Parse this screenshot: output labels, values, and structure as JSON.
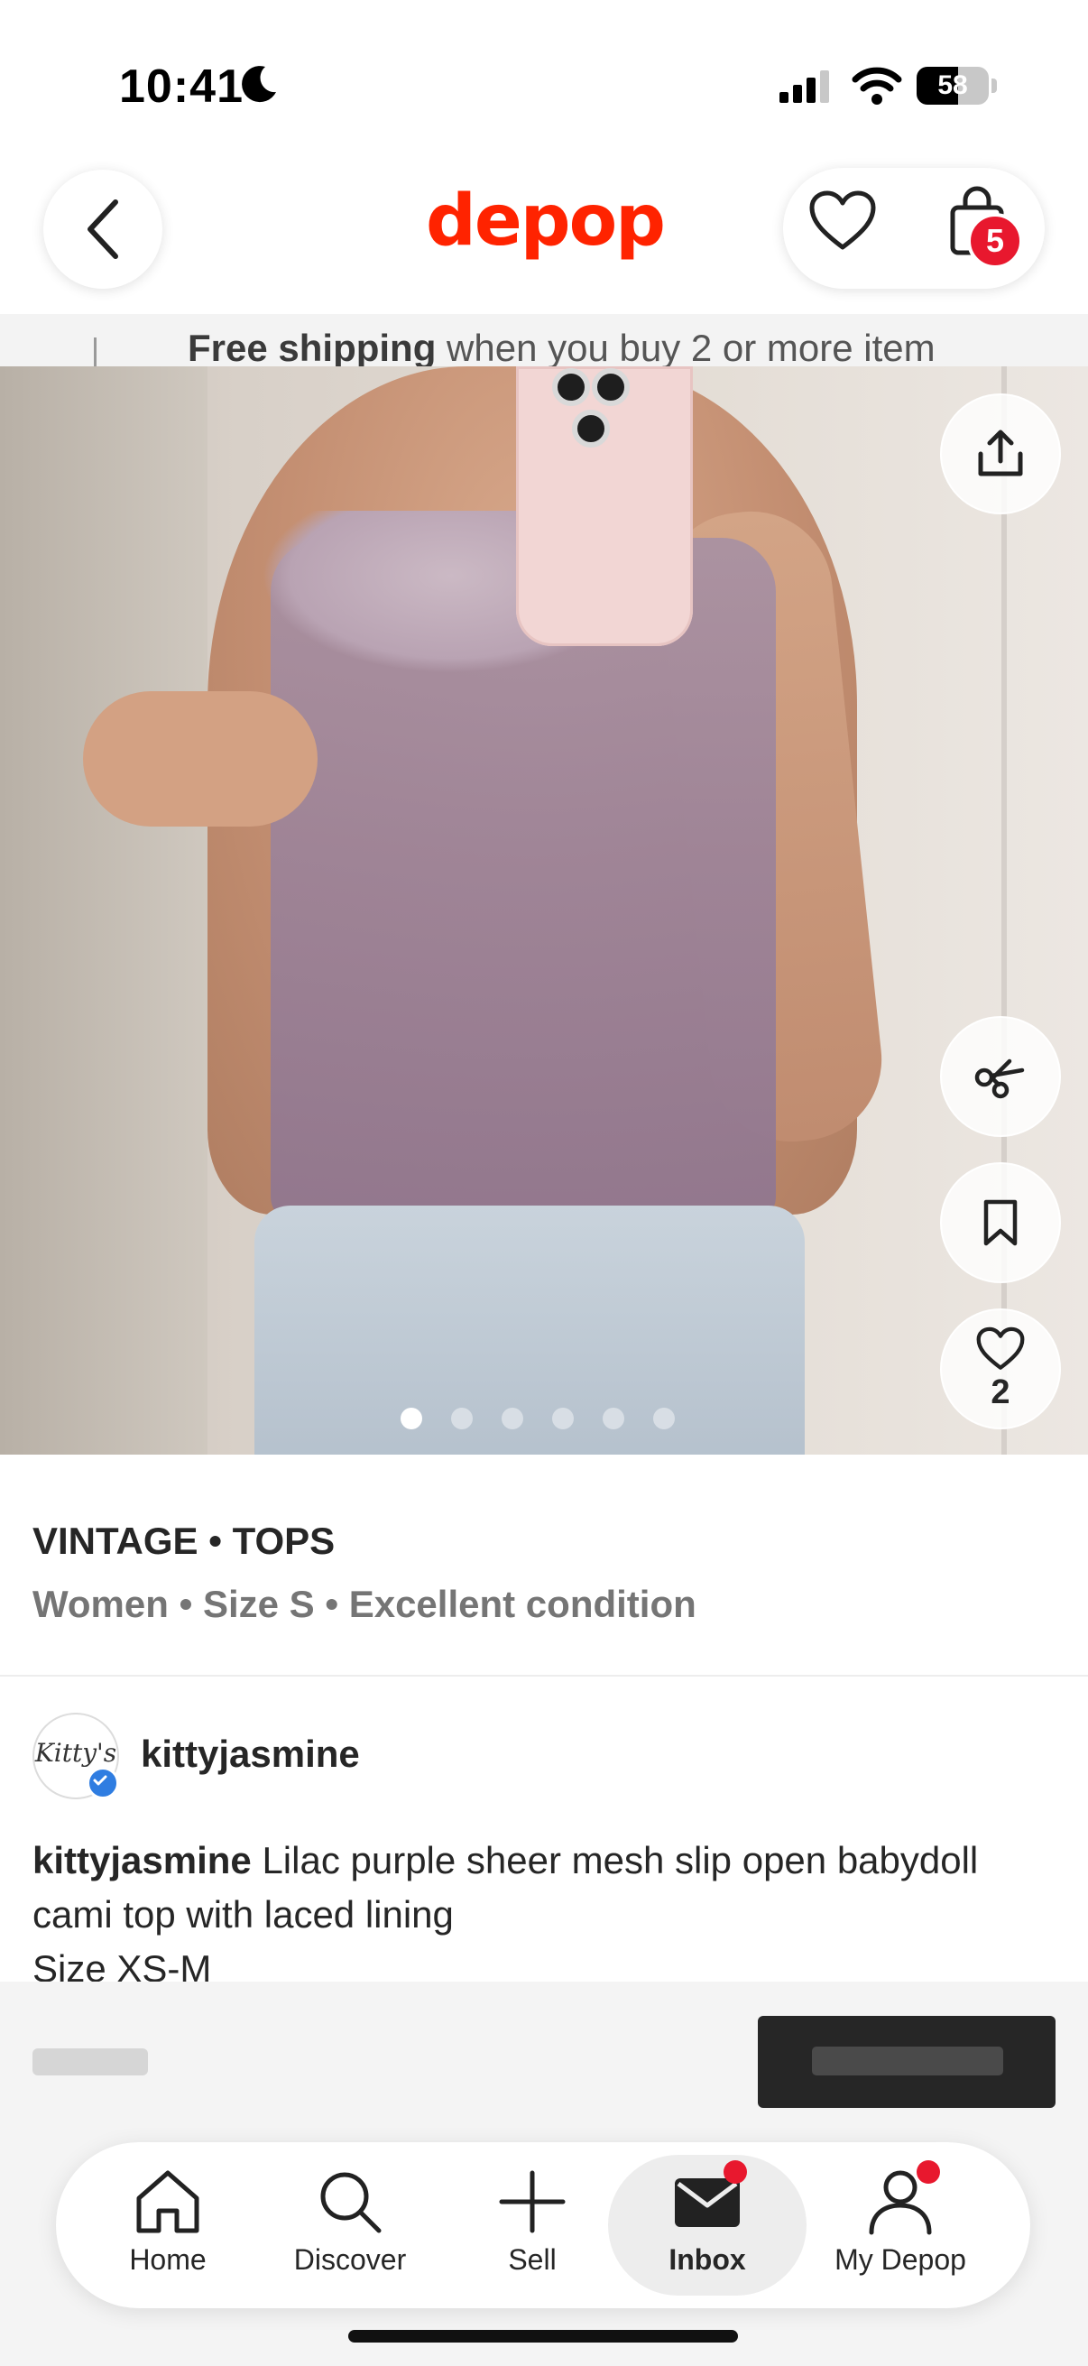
{
  "status_bar": {
    "time": "10:41",
    "battery": "58"
  },
  "header": {
    "logo": "depop",
    "bag_count": "5"
  },
  "promo": {
    "bold": "Free shipping",
    "text": " when you buy 2 or more item"
  },
  "photo": {
    "like_count": "2",
    "image_count": 6,
    "active_index": 0
  },
  "listing": {
    "category": "VINTAGE • TOPS",
    "meta": "Women • Size S • Excellent condition",
    "seller": "kittyjasmine",
    "avatar_text": "Kitty's",
    "description_user": "kittyjasmine",
    "description_text": " Lilac purple sheer mesh slip open babydoll cami top with laced lining",
    "description_size": "Size XS-M"
  },
  "nav": {
    "items": [
      {
        "label": "Home",
        "icon": "home-icon"
      },
      {
        "label": "Discover",
        "icon": "search-icon"
      },
      {
        "label": "Sell",
        "icon": "plus-icon"
      },
      {
        "label": "Inbox",
        "icon": "mail-icon",
        "active": true,
        "has_dot": true
      },
      {
        "label": "My Depop",
        "icon": "person-icon",
        "has_dot": true
      }
    ]
  },
  "colors": {
    "brand": "#ff2300",
    "badge": "#e8182e",
    "verified": "#2f7de1",
    "dark": "#262626"
  }
}
